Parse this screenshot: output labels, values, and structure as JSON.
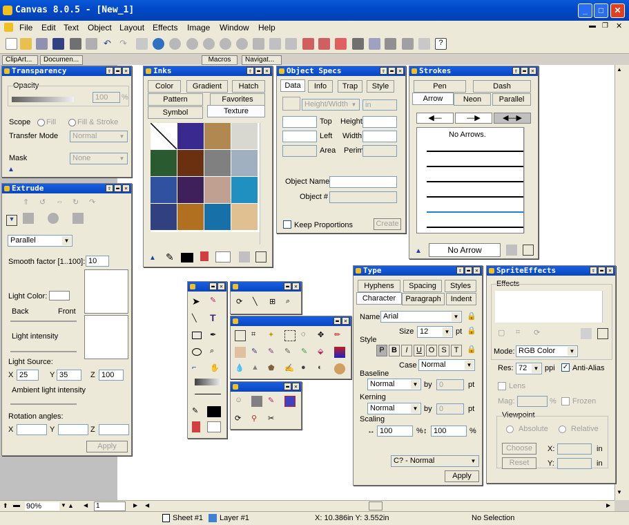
{
  "app": {
    "title": "Canvas 8.0.5 - [New_1]"
  },
  "menu": [
    "File",
    "Edit",
    "Text",
    "Object",
    "Layout",
    "Effects",
    "Image",
    "Window",
    "Help"
  ],
  "doctabs": [
    "ClipArt...",
    "Documen...",
    "Macros",
    "Navigat..."
  ],
  "transparency": {
    "title": "Transparency",
    "opacity_label": "Opacity",
    "opacity_value": "100",
    "opacity_unit": "%",
    "scope_label": "Scope",
    "scope_fill": "Fill",
    "scope_fillstroke": "Fill & Stroke",
    "transfer_label": "Transfer Mode",
    "transfer_value": "Normal",
    "mask_label": "Mask",
    "mask_value": "None"
  },
  "extrude": {
    "title": "Extrude",
    "type_value": "Parallel",
    "smooth_label": "Smooth factor [1..100]:",
    "smooth_value": "10",
    "light_color_label": "Light Color:",
    "back_label": "Back",
    "front_label": "Front",
    "intensity_label": "Light intensity",
    "source_label": "Light Source:",
    "x_label": "X",
    "x_value": "25",
    "y_label": "Y",
    "y_value": "35",
    "z_label": "Z",
    "z_value": "100",
    "ambient_label": "Ambient light intensity",
    "rotation_label": "Rotation angles:",
    "rx": "X",
    "ry": "Y",
    "rz": "Z",
    "apply": "Apply"
  },
  "inks": {
    "title": "Inks",
    "tabs": [
      "Color",
      "Gradient",
      "Hatch",
      "Pattern",
      "Favorites",
      "Symbol",
      "Texture"
    ]
  },
  "objspecs": {
    "title": "Object Specs",
    "tabs": [
      "Data",
      "Info",
      "Trap",
      "Style"
    ],
    "hw_value": "Height/Width",
    "unit_value": "in",
    "top": "Top",
    "height": "Height",
    "left": "Left",
    "width": "Width",
    "area": "Area",
    "perim": "Perim",
    "objname": "Object Name",
    "objnum": "Object #",
    "keep": "Keep Proportions",
    "create": "Create"
  },
  "strokes": {
    "title": "Strokes",
    "tabs": [
      "Pen",
      "Dash",
      "Arrow",
      "Neon",
      "Parallel"
    ],
    "no_arrows": "No Arrows.",
    "current": "No Arrow"
  },
  "type": {
    "title": "Type",
    "tabs": [
      "Hyphens",
      "Spacing",
      "Styles",
      "Character",
      "Paragraph",
      "Indent"
    ],
    "name_label": "Name",
    "name_value": "Arial",
    "size_label": "Size",
    "size_value": "12",
    "size_unit": "pt",
    "style_label": "Style",
    "style_btns": [
      "P",
      "B",
      "I",
      "U",
      "O",
      "S",
      "T"
    ],
    "case_label": "Case",
    "case_value": "Normal",
    "baseline_label": "Baseline",
    "baseline_value": "Normal",
    "by": "by",
    "zero": "0",
    "pt": "pt",
    "kerning_label": "Kerning",
    "kerning_value": "Normal",
    "scaling_label": "Scaling",
    "scale_h": "100",
    "scale_v": "100",
    "pct": "%",
    "preset": "C? - Normal",
    "apply": "Apply"
  },
  "sprite": {
    "title": "SpriteEffects",
    "effects_label": "Effects",
    "mode_label": "Mode:",
    "mode_value": "RGB Color",
    "res_label": "Res:",
    "res_value": "72",
    "res_unit": "ppi",
    "antialias": "Anti-Alias",
    "lens": "Lens",
    "mag": "Mag:",
    "mag_unit": "%",
    "frozen": "Frozen",
    "viewpoint": "Viewpoint",
    "absolute": "Absolute",
    "relative": "Relative",
    "choose": "Choose",
    "reset": "Reset",
    "x": "X:",
    "y": "Y:",
    "in": "in"
  },
  "hscroll": {
    "zoom": "90%",
    "page": "1"
  },
  "status": {
    "sheet": "Sheet #1",
    "layer": "Layer #1",
    "coords": "X: 10.386in  Y: 3.552in",
    "selection": "No Selection"
  }
}
